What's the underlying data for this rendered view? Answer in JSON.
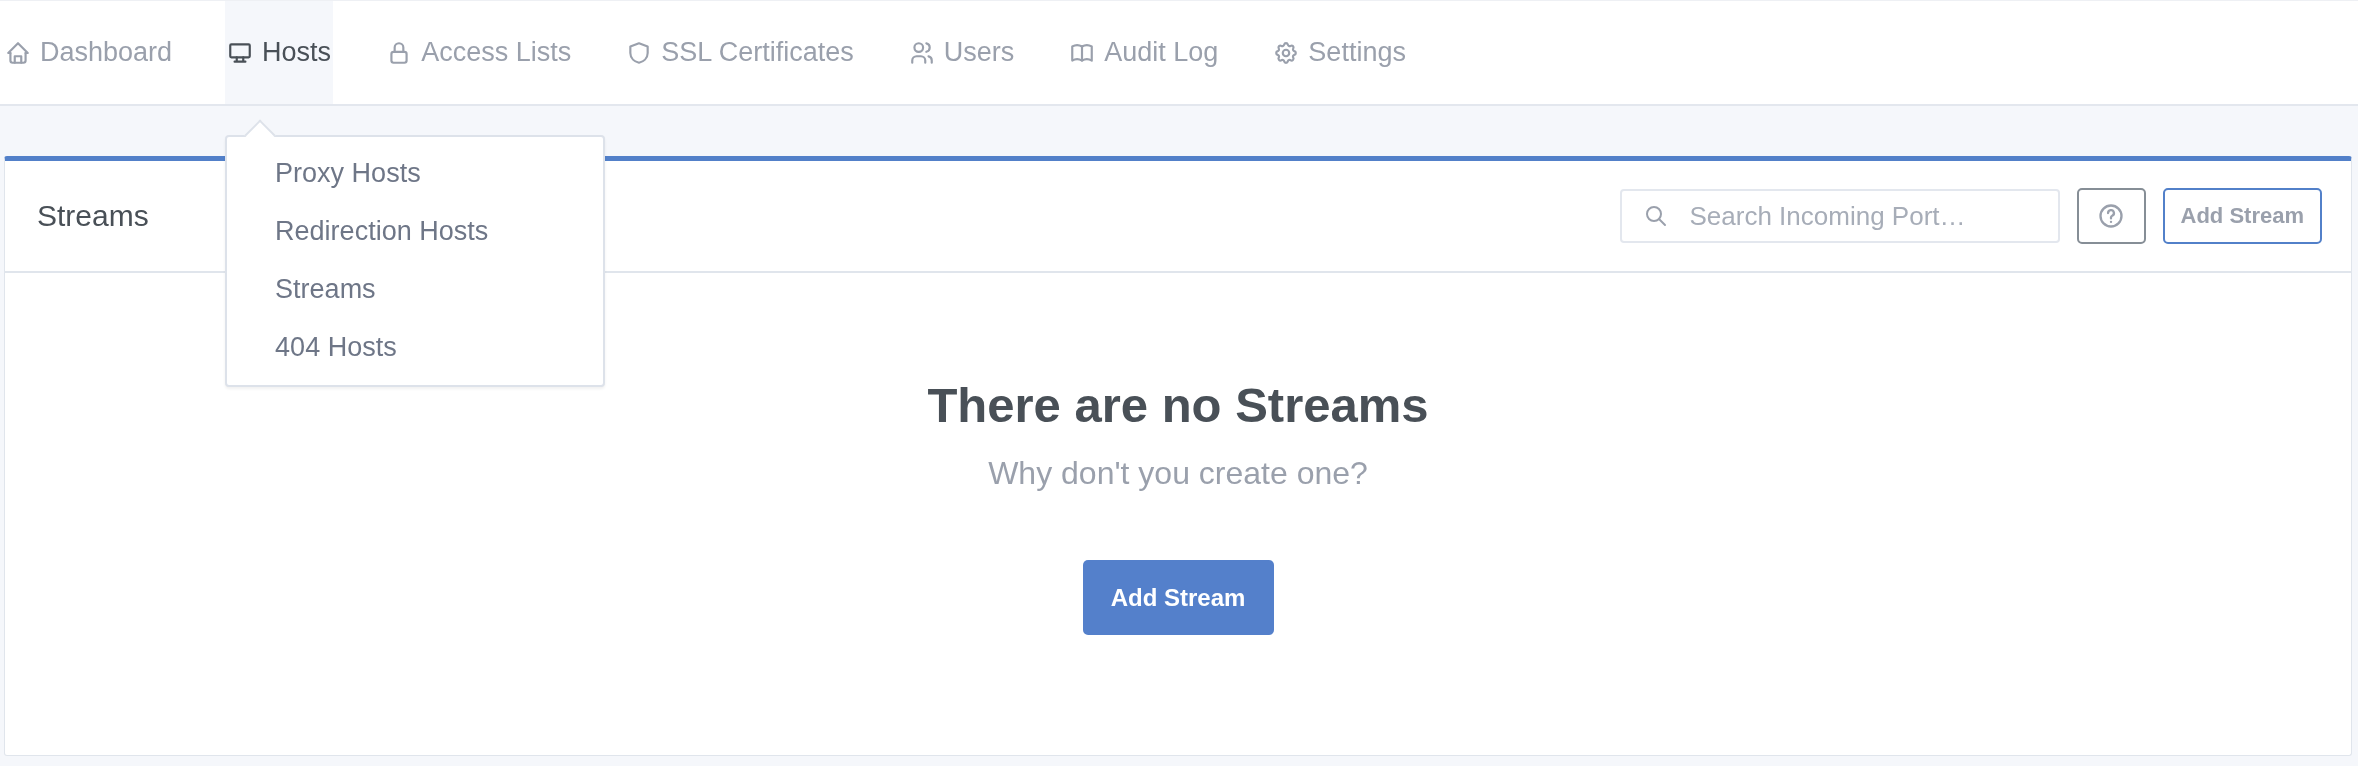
{
  "nav": {
    "items": [
      {
        "label": "Dashboard",
        "selected": false
      },
      {
        "label": "Hosts",
        "selected": true,
        "menu": [
          "Proxy Hosts",
          "Redirection Hosts",
          "Streams",
          "404 Hosts"
        ]
      },
      {
        "label": "Access Lists",
        "selected": false
      },
      {
        "label": "SSL Certificates",
        "selected": false
      },
      {
        "label": "Users",
        "selected": false
      },
      {
        "label": "Audit Log",
        "selected": false
      },
      {
        "label": "Settings",
        "selected": false
      }
    ]
  },
  "card": {
    "title": "Streams",
    "search": {
      "placeholder": "Search Incoming Port…"
    },
    "add_button": "Add Stream"
  },
  "empty_state": {
    "title": "There are no Streams",
    "subtitle": "Why don't you create one?",
    "button": "Add Stream"
  }
}
